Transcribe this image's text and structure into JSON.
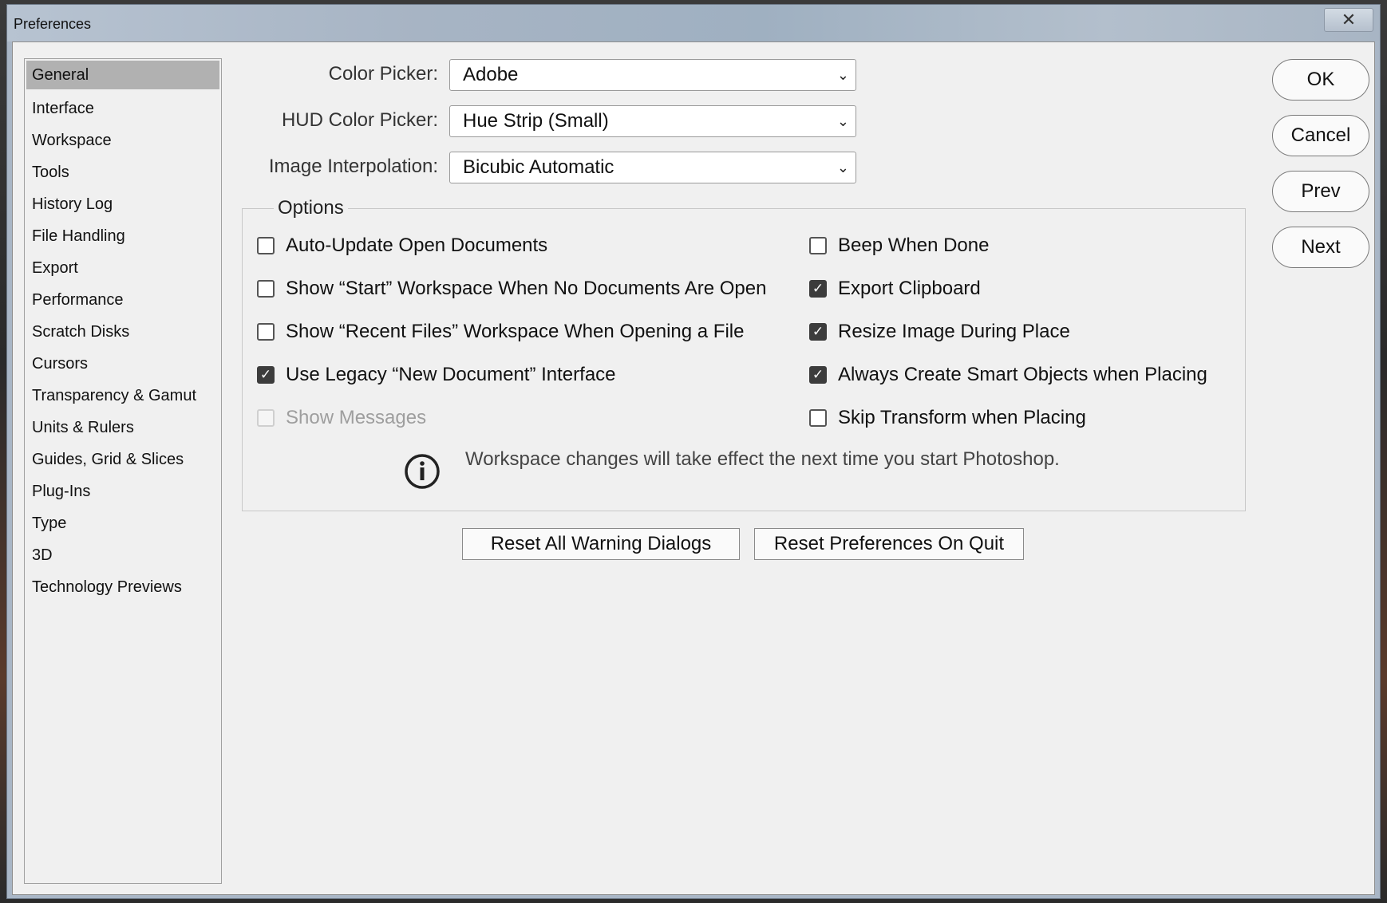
{
  "window": {
    "title": "Preferences",
    "close_glyph": "✕"
  },
  "sidebar": {
    "items": [
      {
        "label": "General",
        "selected": true
      },
      {
        "label": "Interface"
      },
      {
        "label": "Workspace"
      },
      {
        "label": "Tools"
      },
      {
        "label": "History Log"
      },
      {
        "label": "File Handling"
      },
      {
        "label": "Export"
      },
      {
        "label": "Performance"
      },
      {
        "label": "Scratch Disks"
      },
      {
        "label": "Cursors"
      },
      {
        "label": "Transparency & Gamut"
      },
      {
        "label": "Units & Rulers"
      },
      {
        "label": "Guides, Grid & Slices"
      },
      {
        "label": "Plug-Ins"
      },
      {
        "label": "Type"
      },
      {
        "label": "3D"
      },
      {
        "label": "Technology Previews"
      }
    ]
  },
  "fields": {
    "color_picker": {
      "label": "Color Picker:",
      "value": "Adobe"
    },
    "hud_color_picker": {
      "label": "HUD Color Picker:",
      "value": "Hue Strip (Small)"
    },
    "image_interpolation": {
      "label": "Image Interpolation:",
      "value": "Bicubic Automatic"
    }
  },
  "options": {
    "legend": "Options",
    "left": [
      {
        "label": "Auto-Update Open Documents",
        "checked": false
      },
      {
        "label": "Show “Start” Workspace When No Documents Are Open",
        "checked": false
      },
      {
        "label": "Show “Recent Files” Workspace When Opening a File",
        "checked": false
      },
      {
        "label": "Use Legacy “New Document” Interface",
        "checked": true
      },
      {
        "label": "Show Messages",
        "checked": false,
        "disabled": true
      }
    ],
    "right": [
      {
        "label": "Beep When Done",
        "checked": false
      },
      {
        "label": "Export Clipboard",
        "checked": true
      },
      {
        "label": "Resize Image During Place",
        "checked": true
      },
      {
        "label": "Always Create Smart Objects when Placing",
        "checked": true
      },
      {
        "label": "Skip Transform when Placing",
        "checked": false
      }
    ],
    "info_text": "Workspace changes will take effect the next time you start Photoshop."
  },
  "buttons": {
    "reset_warnings": "Reset All Warning Dialogs",
    "reset_prefs": "Reset Preferences On Quit",
    "ok": "OK",
    "cancel": "Cancel",
    "prev": "Prev",
    "next": "Next"
  },
  "icons": {
    "close": "close-icon",
    "chevron": "chevron-down-icon",
    "info": "info-icon",
    "check": "checkmark-icon"
  }
}
